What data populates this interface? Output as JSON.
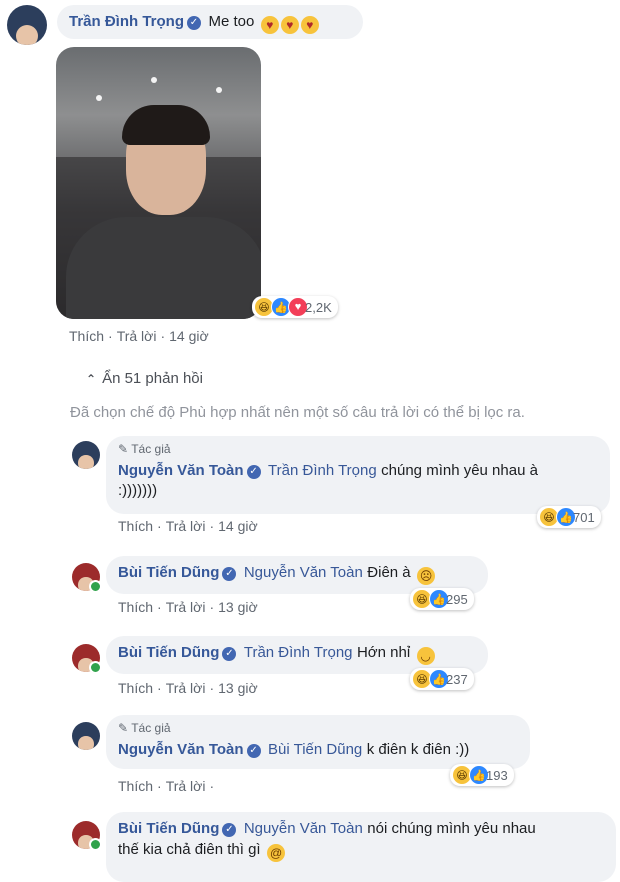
{
  "top_comment": {
    "author": "Trần Đình Trọng",
    "text": "Me too",
    "emoji_icon": "heart-eyes-emoji",
    "reaction_count": "2,2K",
    "actions": {
      "like": "Thích",
      "reply": "Trả lời",
      "time": "14 giờ"
    }
  },
  "replies_toggle": {
    "arrow": "⌃",
    "label": "Ẩn 51 phản hồi"
  },
  "filter_notice": "Đã chọn chế độ Phù hợp nhất nên một số câu trả lời có thể bị lọc ra.",
  "replies": [
    {
      "tag": "Tác giả",
      "author": "Nguyễn Văn Toàn",
      "mention": "Trần Đình Trọng",
      "text_line1": "chúng mình yêu nhau à",
      "text_line2": ":)))))))",
      "reaction_count": "701",
      "actions": {
        "like": "Thích",
        "reply": "Trả lời",
        "time": "14 giờ"
      }
    },
    {
      "author": "Bùi Tiến Dũng",
      "mention": "Nguyễn Văn Toàn",
      "text": "Điên à",
      "emoji_icon": "frowning-emoji",
      "reaction_count": "295",
      "actions": {
        "like": "Thích",
        "reply": "Trả lời",
        "time": "13 giờ"
      }
    },
    {
      "author": "Bùi Tiến Dũng",
      "mention": "Trần Đình Trọng",
      "text": "Hớn nhỉ",
      "emoji_icon": "relieved-emoji",
      "reaction_count": "237",
      "actions": {
        "like": "Thích",
        "reply": "Trả lời",
        "time": "13 giờ"
      }
    },
    {
      "tag": "Tác giả",
      "author": "Nguyễn Văn Toàn",
      "mention": "Bùi Tiến Dũng",
      "text": "k điên k điên :))",
      "reaction_count": "193",
      "actions": {
        "like": "Thích",
        "reply": "Trả lời",
        "time": ""
      }
    },
    {
      "author": "Bùi Tiến Dũng",
      "mention": "Nguyễn Văn Toàn",
      "text_line1": "nói chúng mình yêu nhau",
      "text_line2": "thế kia chả điên thì gì",
      "emoji_icon": "dizzy-face-emoji"
    }
  ]
}
